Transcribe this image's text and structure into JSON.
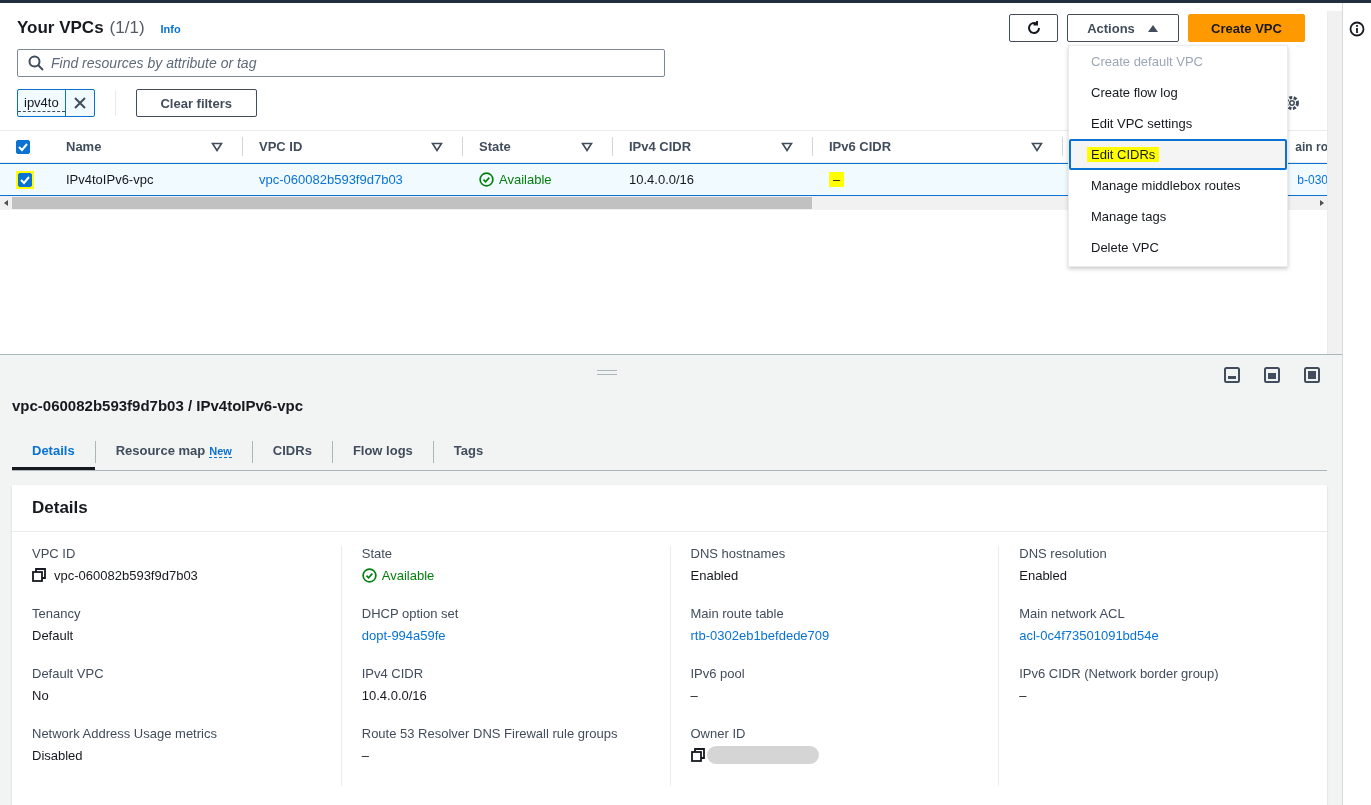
{
  "header": {
    "title": "Your VPCs",
    "count": "(1/1)",
    "info": "Info"
  },
  "toolbar": {
    "actions": "Actions",
    "create": "Create VPC"
  },
  "search": {
    "placeholder": "Find resources by attribute or tag"
  },
  "filter_token": {
    "label": "ipv4to"
  },
  "clear_filters": "Clear filters",
  "table": {
    "select_all": {
      "checked": true
    },
    "columns": [
      {
        "label": "Name",
        "sortable": true
      },
      {
        "label": "VPC ID",
        "sortable": true
      },
      {
        "label": "State",
        "sortable": true
      },
      {
        "label": "IPv4 CIDR",
        "sortable": true
      },
      {
        "label": "IPv6 CIDR",
        "sortable": true
      },
      {
        "label": "ain ro",
        "sortable": false
      }
    ],
    "rows": [
      {
        "selected": true,
        "checked": true,
        "highlighted": true,
        "cells": [
          {
            "kind": "text",
            "text": "IPv4toIPv6-vpc"
          },
          {
            "kind": "link",
            "text": "vpc-060082b593f9d7b03"
          },
          {
            "kind": "status",
            "text": "Available"
          },
          {
            "kind": "text",
            "text": "10.4.0.0/16"
          },
          {
            "kind": "text",
            "text": "–",
            "highlighted": true
          },
          {
            "kind": "link",
            "text": "b-030"
          }
        ]
      }
    ]
  },
  "menu": {
    "items": [
      {
        "label": "Create default VPC",
        "disabled": true,
        "selected": false,
        "highlighted": false
      },
      {
        "label": "Create flow log",
        "disabled": false,
        "selected": false,
        "highlighted": false
      },
      {
        "label": "Edit VPC settings",
        "disabled": false,
        "selected": false,
        "highlighted": false
      },
      {
        "label": "Edit CIDRs",
        "disabled": false,
        "selected": true,
        "highlighted": true
      },
      {
        "label": "Manage middlebox routes",
        "disabled": false,
        "selected": false,
        "highlighted": false
      },
      {
        "label": "Manage tags",
        "disabled": false,
        "selected": false,
        "highlighted": false
      },
      {
        "label": "Delete VPC",
        "disabled": false,
        "selected": false,
        "highlighted": false
      }
    ]
  },
  "detail": {
    "title": "vpc-060082b593f9d7b03 / IPv4toIPv6-vpc",
    "tabs": [
      {
        "label": "Details",
        "selected": true
      },
      {
        "label": "Resource map",
        "badge": "New",
        "selected": false
      },
      {
        "label": "CIDRs",
        "selected": false
      },
      {
        "label": "Flow logs",
        "selected": false
      },
      {
        "label": "Tags",
        "selected": false
      }
    ],
    "card_title": "Details",
    "columns": [
      [
        {
          "label": "VPC ID",
          "kind": "copy",
          "value": "vpc-060082b593f9d7b03"
        },
        {
          "label": "Tenancy",
          "kind": "text",
          "value": "Default"
        },
        {
          "label": "Default VPC",
          "kind": "text",
          "value": "No"
        },
        {
          "label": "Network Address Usage metrics",
          "kind": "text",
          "value": "Disabled"
        }
      ],
      [
        {
          "label": "State",
          "kind": "status",
          "value": "Available"
        },
        {
          "label": "DHCP option set",
          "kind": "link",
          "value": "dopt-994a59fe"
        },
        {
          "label": "IPv4 CIDR",
          "kind": "text",
          "value": "10.4.0.0/16"
        },
        {
          "label": "Route 53 Resolver DNS Firewall rule groups",
          "kind": "text",
          "value": "–"
        }
      ],
      [
        {
          "label": "DNS hostnames",
          "kind": "text",
          "value": "Enabled"
        },
        {
          "label": "Main route table",
          "kind": "link",
          "value": "rtb-0302eb1befdede709"
        },
        {
          "label": "IPv6 pool",
          "kind": "text",
          "value": "–"
        },
        {
          "label": "Owner ID",
          "kind": "redacted"
        }
      ],
      [
        {
          "label": "DNS resolution",
          "kind": "text",
          "value": "Enabled"
        },
        {
          "label": "Main network ACL",
          "kind": "link",
          "value": "acl-0c4f73501091bd54e"
        },
        {
          "label": "IPv6 CIDR (Network border group)",
          "kind": "text",
          "value": "–"
        }
      ]
    ]
  }
}
